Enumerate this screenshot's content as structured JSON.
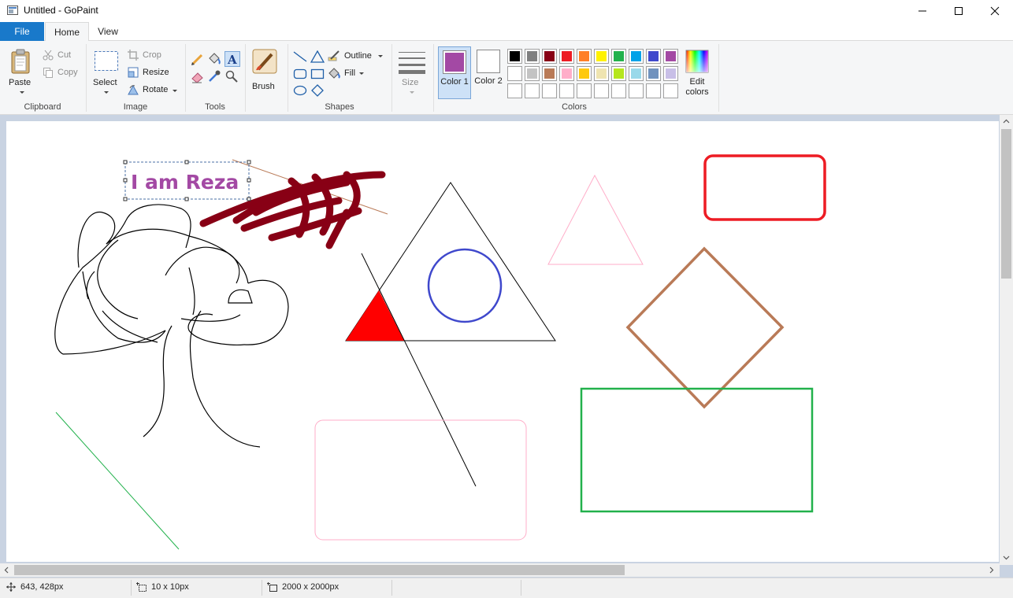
{
  "window": {
    "title": "Untitled - GoPaint"
  },
  "menu": {
    "tabs": [
      {
        "label": "File"
      },
      {
        "label": "Home"
      },
      {
        "label": "View"
      }
    ]
  },
  "ribbon": {
    "clipboard": {
      "group_label": "Clipboard",
      "paste_label": "Paste",
      "cut_label": "Cut",
      "copy_label": "Copy"
    },
    "image": {
      "group_label": "Image",
      "select_label": "Select",
      "crop_label": "Crop",
      "resize_label": "Resize",
      "rotate_label": "Rotate"
    },
    "tools": {
      "group_label": "Tools"
    },
    "brush": {
      "label": "Brush"
    },
    "shapes": {
      "group_label": "Shapes",
      "outline_label": "Outline",
      "fill_label": "Fill"
    },
    "size": {
      "label": "Size"
    },
    "colors": {
      "group_label": "Colors",
      "color1_label": "Color 1",
      "color2_label": "Color 2",
      "edit_colors_label": "Edit colors",
      "color1_value": "#a349a4",
      "color2_value": "#ffffff",
      "palette_row1": [
        "#000000",
        "#7f7f7f",
        "#880015",
        "#ed1c24",
        "#ff7f27",
        "#fff200",
        "#22b14c",
        "#00a2e8",
        "#3f48cc",
        "#a349a4"
      ],
      "palette_row2": [
        "#ffffff",
        "#c3c3c3",
        "#b97a57",
        "#ffaec9",
        "#ffc90e",
        "#efe4b0",
        "#b5e61d",
        "#99d9ea",
        "#7092be",
        "#c8bfe7"
      ],
      "palette_row3": [
        "",
        "",
        "",
        "",
        "",
        "",
        "",
        "",
        "",
        ""
      ]
    }
  },
  "canvas": {
    "text_object": "I am Reza",
    "text_color": "#a349a4",
    "colors": {
      "scribble": "#880015",
      "red_triangle": "#ff0000",
      "blue_circle": "#3f48cc",
      "pink": "#ffaec9",
      "red_rect": "#ed1c24",
      "brown_diamond": "#b97a57",
      "green_rect": "#22b14c",
      "teal_line": "#22b14c"
    }
  },
  "status": {
    "cursor_pos": "643, 428px",
    "selection_size": "10 x 10px",
    "image_size": "2000 x 2000px"
  }
}
